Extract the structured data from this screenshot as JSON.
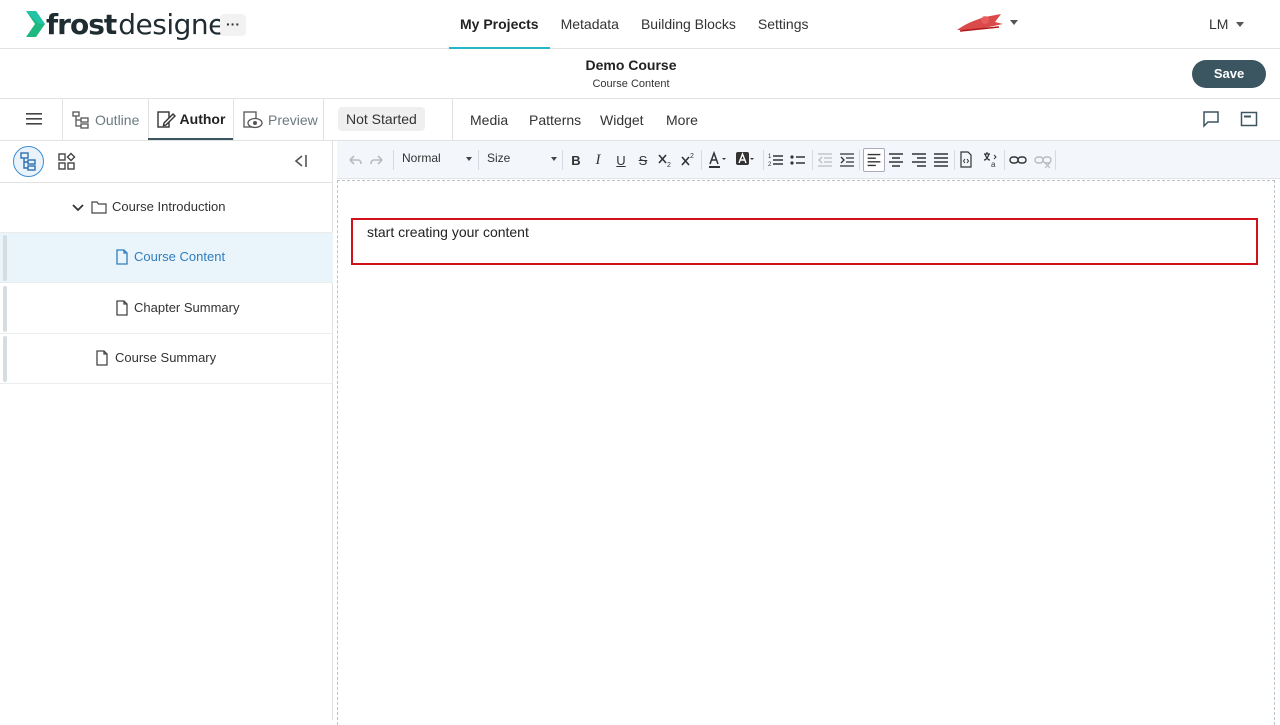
{
  "app": {
    "brand_bold": "frost",
    "brand_light": "designer",
    "more_label": "···"
  },
  "nav": {
    "links": [
      "My Projects",
      "Metadata",
      "Building Blocks",
      "Settings"
    ],
    "active": "My Projects",
    "user_initials": "LM"
  },
  "course": {
    "title": "Demo Course",
    "subtitle": "Course Content",
    "save_label": "Save"
  },
  "modes": {
    "tabs": [
      {
        "label": "Outline",
        "icon": "outline-icon"
      },
      {
        "label": "Author",
        "icon": "author-icon"
      },
      {
        "label": "Preview",
        "icon": "preview-icon"
      }
    ],
    "active": "Author",
    "status": "Not Started",
    "menus": [
      "Media",
      "Patterns",
      "Widget",
      "More"
    ]
  },
  "tree": [
    {
      "label": "Course Introduction",
      "type": "folder",
      "expanded": true
    },
    {
      "label": "Course Content",
      "type": "page",
      "selected": true
    },
    {
      "label": "Chapter Summary",
      "type": "page"
    },
    {
      "label": "Course Summary",
      "type": "page"
    }
  ],
  "toolbar": {
    "format_value": "Normal",
    "size_value": "Size",
    "buttons": [
      "undo",
      "redo",
      "bold",
      "italic",
      "underline",
      "strikethrough",
      "subscript",
      "superscript",
      "text-color",
      "background-color",
      "numbered-list",
      "bulleted-list",
      "outdent",
      "indent",
      "align-left",
      "align-center",
      "align-right",
      "justify",
      "source",
      "language",
      "link",
      "unlink"
    ],
    "bold_glyph": "B",
    "italic_glyph": "I",
    "underline_glyph": "U",
    "strike_glyph": "S"
  },
  "editor": {
    "text": "start creating your content"
  },
  "colors": {
    "accent": "#27b7c4",
    "save_bg": "#3b5561",
    "selected_text": "#2f7dbf",
    "highlight_border": "#d0101a"
  }
}
